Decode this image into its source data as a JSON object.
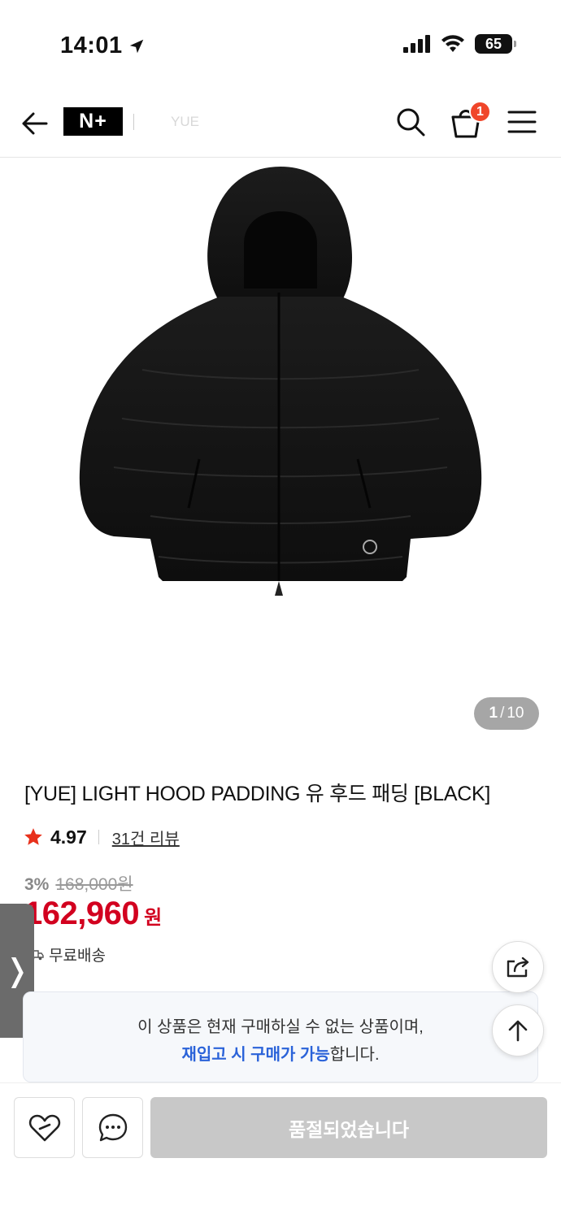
{
  "status_bar": {
    "time": "14:01",
    "battery": "65"
  },
  "header": {
    "logo_text": "N+",
    "brand_text": "YUE",
    "cart_count": "1"
  },
  "gallery": {
    "current": "1",
    "total": "10"
  },
  "product": {
    "title": "[YUE] LIGHT HOOD PADDING 유 후드 패딩 [BLACK]",
    "rating": "4.97",
    "review_count": "31건 리뷰",
    "discount_rate": "3%",
    "original_price": "168,000원",
    "price": "162,960",
    "price_unit": "원",
    "shipping": "무료배송"
  },
  "notice": {
    "line1": "이 상품은 현재 구매하실 수 없는 상품이며,",
    "line2_highlight": "재입고 시 구매가 가능",
    "line2_rest": "합니다."
  },
  "bottom_bar": {
    "soldout_label": "품절되었습니다"
  },
  "side_tab": {
    "glyph": "❭"
  },
  "colors": {
    "price_red": "#d2001f",
    "badge_orange": "#f0462a",
    "highlight_blue": "#2b63d9",
    "star_red": "#e8311c"
  },
  "icons": [
    "location-arrow-icon",
    "signal-icon",
    "wifi-icon",
    "battery-icon",
    "back-arrow-icon",
    "search-icon",
    "cart-icon",
    "menu-icon",
    "star-icon",
    "truck-icon",
    "share-icon",
    "arrow-up-icon",
    "heart-icon",
    "chat-icon"
  ]
}
